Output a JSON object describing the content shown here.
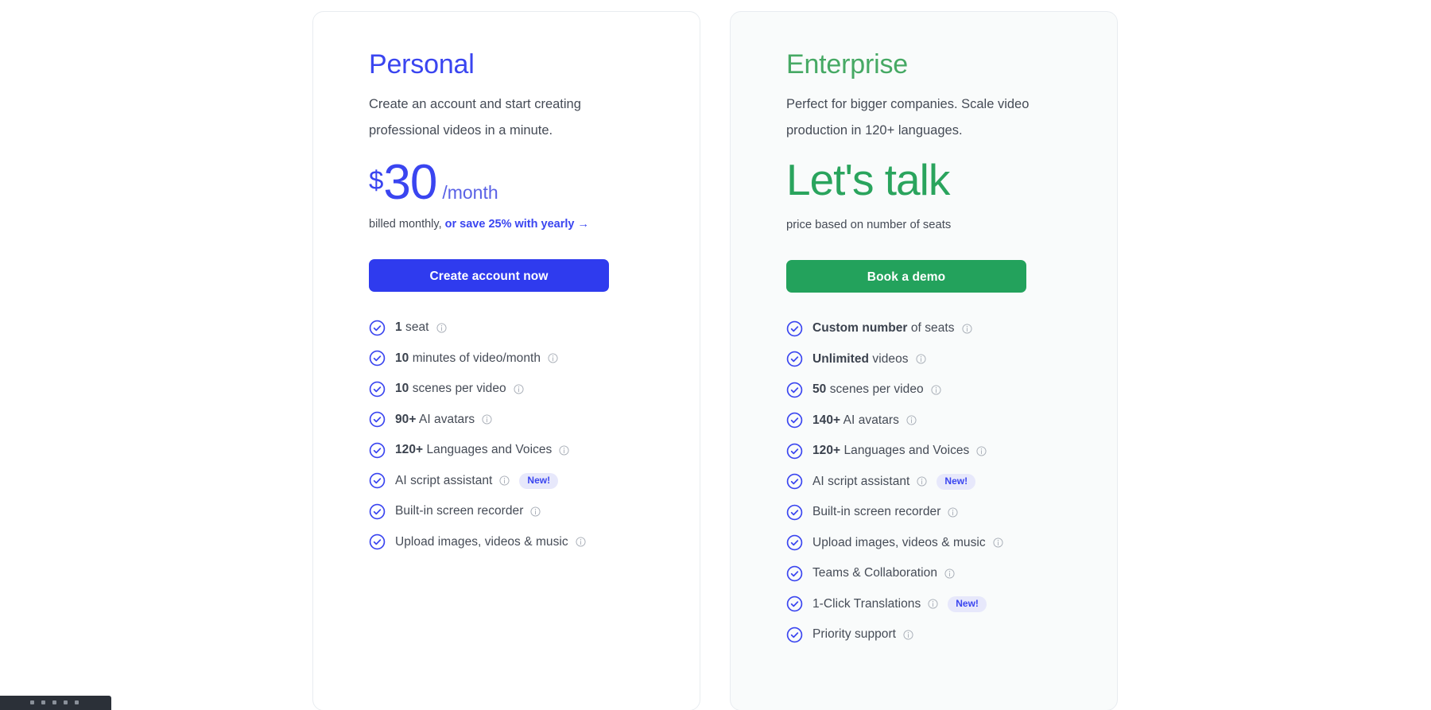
{
  "plans": [
    {
      "name": "Personal",
      "description": "Create an account and start creating professional videos in a minute.",
      "currency": "$",
      "amount": "30",
      "period": "/month",
      "billing_prefix": "billed monthly, ",
      "billing_link": "or save 25% with yearly →",
      "cta_label": "Create account now",
      "features": [
        {
          "bold": "1",
          "text": " seat",
          "info": "info-icon",
          "badge": ""
        },
        {
          "bold": "10",
          "text": " minutes of video/month",
          "info": "info-icon",
          "badge": ""
        },
        {
          "bold": "10",
          "text": " scenes per video",
          "info": "info-icon",
          "badge": ""
        },
        {
          "bold": "90+",
          "text": " AI avatars",
          "info": "info-icon",
          "badge": ""
        },
        {
          "bold": "120+",
          "text": " Languages and Voices",
          "info": "info-icon",
          "badge": ""
        },
        {
          "bold": "",
          "text": "AI script assistant",
          "info": "info-icon",
          "badge": "New!"
        },
        {
          "bold": "",
          "text": "Built-in screen recorder",
          "info": "info-icon",
          "badge": ""
        },
        {
          "bold": "",
          "text": "Upload images, videos & music",
          "info": "info-icon",
          "badge": ""
        }
      ]
    },
    {
      "name": "Enterprise",
      "description": "Perfect for bigger companies. Scale video production in 120+ languages.",
      "price_text": "Let's talk",
      "price_note": "price based on number of seats",
      "cta_label": "Book a demo",
      "features": [
        {
          "bold": "Custom number",
          "text": " of seats",
          "info": "info-icon",
          "badge": ""
        },
        {
          "bold": "Unlimited",
          "text": " videos",
          "info": "info-icon",
          "badge": ""
        },
        {
          "bold": "50",
          "text": " scenes per video",
          "info": "info-icon",
          "badge": ""
        },
        {
          "bold": "140+",
          "text": " AI avatars",
          "info": "info-icon",
          "badge": ""
        },
        {
          "bold": "120+",
          "text": " Languages and Voices",
          "info": "info-icon",
          "badge": ""
        },
        {
          "bold": "",
          "text": "AI script assistant",
          "info": "info-icon",
          "badge": "New!"
        },
        {
          "bold": "",
          "text": "Built-in screen recorder",
          "info": "info-icon",
          "badge": ""
        },
        {
          "bold": "",
          "text": "Upload images, videos & music",
          "info": "info-icon",
          "badge": ""
        },
        {
          "bold": "",
          "text": "Teams & Collaboration",
          "info": "info-icon",
          "badge": ""
        },
        {
          "bold": "",
          "text": "1-Click Translations",
          "info": "info-icon",
          "badge": "New!"
        },
        {
          "bold": "",
          "text": "Priority support",
          "info": "info-icon",
          "badge": ""
        }
      ]
    }
  ],
  "colors": {
    "personal_accent": "#3a45f0",
    "enterprise_accent": "#2aa45d",
    "check": "#3a45f0",
    "badge_bg": "#e7e8fb",
    "text": "#454b56"
  }
}
